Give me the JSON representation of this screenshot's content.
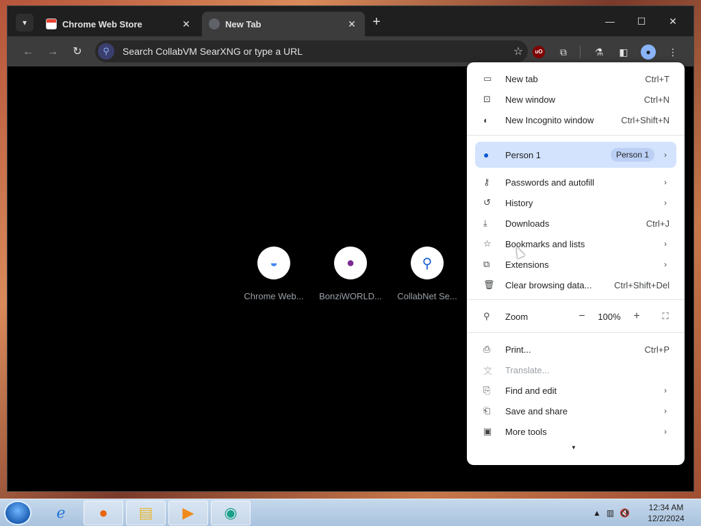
{
  "tabs": [
    {
      "title": "Chrome Web Store",
      "active": false
    },
    {
      "title": "New Tab",
      "active": true
    }
  ],
  "window_controls": {
    "minimize": "—",
    "maximize": "☐",
    "close": "✕"
  },
  "omnibox": {
    "placeholder": "Search CollabVM SearXNG or type a URL"
  },
  "shortcuts": [
    {
      "label": "Chrome Web...",
      "icon": "chrome-web-store-icon"
    },
    {
      "label": "BonziWORLD...",
      "icon": "bonziworld-icon"
    },
    {
      "label": "CollabNet Se...",
      "icon": "search-magnifier-icon"
    }
  ],
  "menu": {
    "new_tab": {
      "label": "New tab",
      "shortcut": "Ctrl+T"
    },
    "new_window": {
      "label": "New window",
      "shortcut": "Ctrl+N"
    },
    "incognito": {
      "label": "New Incognito window",
      "shortcut": "Ctrl+Shift+N"
    },
    "profile": {
      "label": "Person 1",
      "chip": "Person 1"
    },
    "passwords": {
      "label": "Passwords and autofill"
    },
    "history": {
      "label": "History"
    },
    "downloads": {
      "label": "Downloads",
      "shortcut": "Ctrl+J"
    },
    "bookmarks": {
      "label": "Bookmarks and lists"
    },
    "extensions": {
      "label": "Extensions"
    },
    "clear_data": {
      "label": "Clear browsing data...",
      "shortcut": "Ctrl+Shift+Del"
    },
    "zoom": {
      "label": "Zoom",
      "value": "100%",
      "minus": "−",
      "plus": "+"
    },
    "print": {
      "label": "Print...",
      "shortcut": "Ctrl+P"
    },
    "translate": {
      "label": "Translate..."
    },
    "find_edit": {
      "label": "Find and edit"
    },
    "save_share": {
      "label": "Save and share"
    },
    "more_tools": {
      "label": "More tools"
    }
  },
  "taskbar": {
    "clock_time": "12:34 AM",
    "clock_date": "12/2/2024",
    "apps": [
      "internet-explorer-icon",
      "firefox-icon",
      "file-explorer-icon",
      "media-player-icon",
      "chrome-icon"
    ]
  },
  "colors": {
    "accent": "#8ab4f8",
    "menu_bg": "#ffffff",
    "profile_bg": "#d3e3fd"
  }
}
